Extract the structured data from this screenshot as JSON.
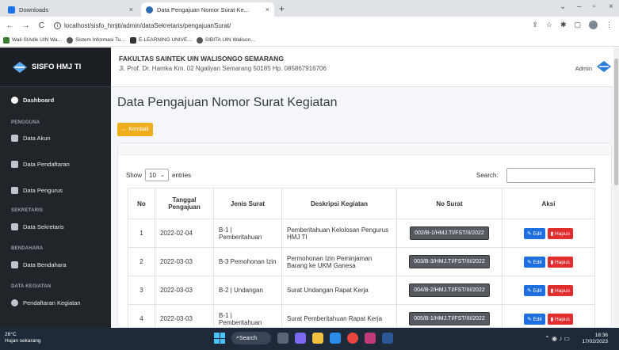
{
  "browser": {
    "tabs": [
      {
        "label": "Downloads"
      },
      {
        "label": "Data Pengajuan Nomor Surat Ke..."
      }
    ],
    "new_tab": "+",
    "url": "localhost/sisfo_hmjti/admin/dataSekretaris/pengajuanSurat/",
    "bookmarks": [
      {
        "label": "Wali-SIAdik UIN Wa..."
      },
      {
        "label": "Sistem Informasi Tu..."
      },
      {
        "label": "E-LEARNING UNIVE..."
      },
      {
        "label": "SIBITA UIN Walison..."
      }
    ]
  },
  "sidebar": {
    "brand": "SISFO HMJ TI",
    "dashboard": "Dashboard",
    "sections": [
      {
        "head": "PENGGUNA",
        "items": [
          "Data Akun",
          "Data Pendaftaran",
          "Data Pengurus"
        ]
      },
      {
        "head": "SEKRETARIS",
        "items": [
          "Data Sekretaris"
        ]
      },
      {
        "head": "BENDAHARA",
        "items": [
          "Data Bendahara"
        ]
      },
      {
        "head": "DATA KEGIATAN",
        "items": [
          "Pendaftaran Kegiatan"
        ]
      }
    ]
  },
  "header": {
    "faculty": "FAKULTAS SAINTEK UIN WALISONGO SEMARANG",
    "address": "Jl. Prof. Dr. Hamka Km. 02 Ngaliyan Semarang 50185 Hp. 085867916706",
    "user": "Admin"
  },
  "main": {
    "title": "Data Pengajuan Nomor Surat Kegiatan",
    "back_label": "← Kembali",
    "show_label": "Show",
    "entries_value": "10",
    "entries_label": "entries",
    "search_label": "Search:",
    "columns": [
      "No",
      "Tanggal Pengajuan",
      "Jenis Surat",
      "Deskripsi Kegiatan",
      "No Surat",
      "Aksi"
    ],
    "edit_label": "Edit",
    "delete_label": "Hapus",
    "rows": [
      {
        "no": "1",
        "tanggal": "2022-02-04",
        "jenis": "B-1 | Pemberitahuan",
        "deskripsi": "Pemberitahuan Kelolosan Pengurus HMJ TI",
        "nosurat": "002/B-1/HMJ.TI/FST/II/2022"
      },
      {
        "no": "2",
        "tanggal": "2022-03-03",
        "jenis": "B-3 Pemohonan Izin",
        "deskripsi": "Permohonan Izin Peminjaman Barang ke UKM Ganesa",
        "nosurat": "003/B-3/HMJ.TI/FST/III/2022"
      },
      {
        "no": "3",
        "tanggal": "2022-03-03",
        "jenis": "B-2 | Undangan",
        "deskripsi": "Surat Undangan Rapat Kerja",
        "nosurat": "004/B-2/HMJ.TI/FST/III/2022"
      },
      {
        "no": "4",
        "tanggal": "2022-03-03",
        "jenis": "B-1 | Pemberitahuan",
        "deskripsi": "Surat Pemberitahuan Rapat Kerja",
        "nosurat": "005/B-1/HMJ.TI/FST/III/2022"
      }
    ]
  },
  "taskbar": {
    "weather_temp": "26°C",
    "weather_desc": "Hujan sekarang",
    "search": "Search",
    "time": "18:36",
    "date": "17/02/2023"
  },
  "colors": {
    "sidebar_bg": "#212529",
    "back_button": "#f0ad1c",
    "edit_button": "#1f6fe0",
    "delete_button": "#e02d2d",
    "badge": "#555b61"
  }
}
